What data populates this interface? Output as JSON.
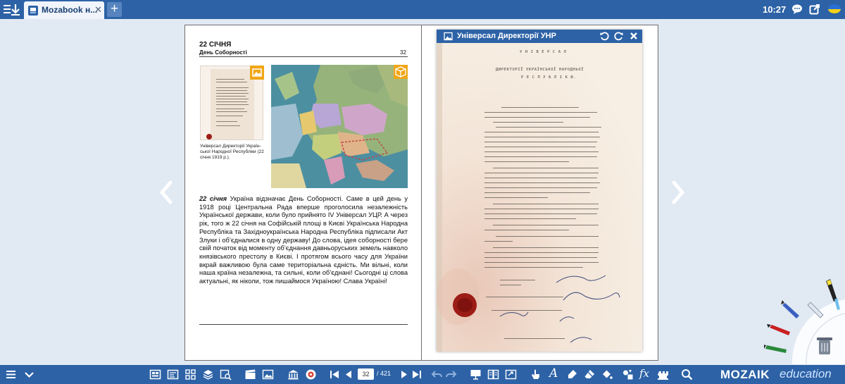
{
  "topbar": {
    "menu_icon": "download-menu-icon",
    "tab_title": "Mozabook н...",
    "tab_close": "✕",
    "tab_add": "+",
    "clock": "10:27",
    "icons": [
      "chat-icon",
      "external-edit-icon"
    ]
  },
  "left_page": {
    "date": "22 СІЧНЯ",
    "name": "День Соборності",
    "number": "32",
    "caption": "Універсал Директорії Укра­їн­ської Народної Республіки (22 січня 1919 р.).",
    "body_lead": "22 січня",
    "body": " Україна відзначає День Соборності. Саме в цей день у 1918 році Центральна Рада вперше проголосила незалежність Української держави, коли було прийнято IV Універсал УЦР. А через рік, того ж 22 січня на Софійській площі в Києві Українська Народна Республіка та Західноукраїнська Народна Республіка підписали Акт Злуки і об’єдналися в одну державу! До слова, ідея соборності бере свій початок від моменту об’єднання давньоруських земель навколо князівського престолу в Києві. І протягом всього часу для України вкрай важливою була саме територіальна єдність. Ми вільні, коли наша країна незалежна, та сильні, коли об’єднані! Сьогодні ці слова актуальні, як ніколи, тож пишаймося Україною! Слава Україні!"
  },
  "popup": {
    "title": "Універсал Директорії УНР",
    "doc_heading_1": "У Н І В Е Р С А Л",
    "doc_heading_2": "ДИРЕКТОРІЇ УКРАЇНСЬКОЇ НАРОДНЬОЇ",
    "doc_heading_3": "Р Е С П У Б Л І К И."
  },
  "bottombar": {
    "page_current": "32",
    "page_total": "/ 421",
    "logo_main": "MOZAIK",
    "logo_sub": "education"
  },
  "colors": {
    "bar_blue": "#2d62a6",
    "badge_orange": "#f0a616",
    "seal_red": "#9c1c16"
  }
}
